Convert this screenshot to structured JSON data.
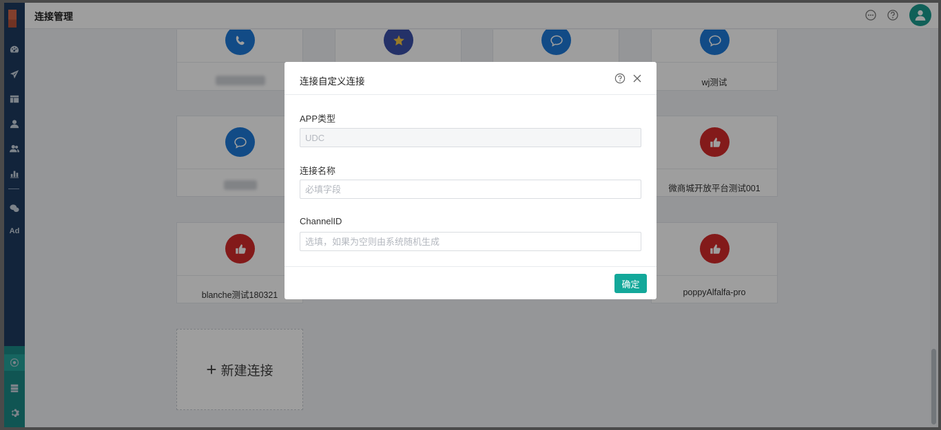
{
  "header": {
    "title": "连接管理",
    "icons": [
      "chat-icon",
      "help-icon",
      "user-avatar-icon"
    ]
  },
  "sidebar": {
    "icons": [
      "dashboard-icon",
      "send-icon",
      "layout-icon",
      "user-icon",
      "users-icon",
      "bar-chart-icon",
      "wechat-icon",
      "connection-icon",
      "server-icon",
      "settings-icon"
    ],
    "ad_label": "Ad"
  },
  "cards": [
    {
      "name": "",
      "color": "#1e7ad8",
      "icon": "call-icon"
    },
    {
      "name": "",
      "color": "#3b4fa8",
      "icon": "badge-icon"
    },
    {
      "name": "",
      "color": "#1e7ad8",
      "icon": "chat-bubble-icon"
    },
    {
      "name": "wj测试",
      "color": "#1e7ad8",
      "icon": "chat-bubble-icon"
    },
    {
      "name": "",
      "color": "#1e7ad8",
      "icon": "chat-bubble-icon"
    },
    {
      "name": "微商城开放平台测试001",
      "color": "#d32a2a",
      "icon": "thumbs-up-icon"
    },
    {
      "name": "blanche测试180321",
      "color": "#d32a2a",
      "icon": "thumbs-up-icon"
    },
    {
      "name": "poppyAlfalfa-pro",
      "color": "#d32a2a",
      "icon": "thumbs-up-icon"
    }
  ],
  "new_connection": {
    "label": "新建连接"
  },
  "modal": {
    "title": "连接自定义连接",
    "app_type_label": "APP类型",
    "app_type_value": "UDC",
    "name_label": "连接名称",
    "name_placeholder": "必填字段",
    "channel_label": "ChannelID",
    "channel_placeholder": "选填，如果为空则由系统随机生成",
    "confirm_label": "确定"
  }
}
